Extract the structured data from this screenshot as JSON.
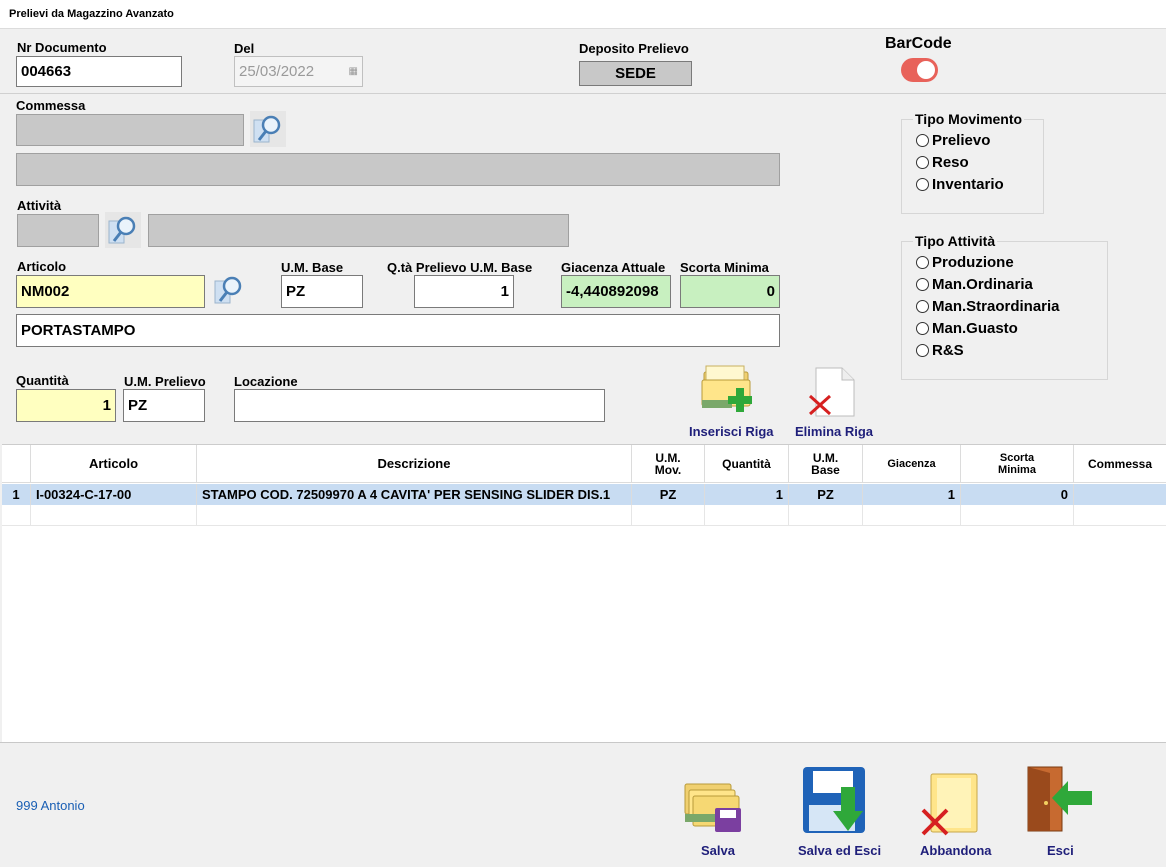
{
  "window": {
    "title": "Prelievi da Magazzino Avanzato"
  },
  "header": {
    "nr_documento_label": "Nr Documento",
    "nr_documento_value": "004663",
    "del_label": "Del",
    "del_value": "25/03/2022",
    "deposito_label": "Deposito Prelievo",
    "deposito_value": "SEDE",
    "barcode_label": "BarCode",
    "barcode_on": true
  },
  "form": {
    "commessa_label": "Commessa",
    "attivita_label": "Attività",
    "articolo_label": "Articolo",
    "articolo_value": "NM002",
    "um_base_label": "U.M. Base",
    "um_base_value": "PZ",
    "qta_prelievo_label": "Q.tà Prelievo U.M. Base",
    "qta_prelievo_value": "1",
    "giacenza_label": "Giacenza Attuale",
    "giacenza_value": "-4,440892098",
    "scorta_label": "Scorta Minima",
    "scorta_value": "0",
    "descrizione_value": "PORTASTAMPO",
    "quantita_label": "Quantità",
    "quantita_value": "1",
    "um_prelievo_label": "U.M. Prelievo",
    "um_prelievo_value": "PZ",
    "locazione_label": "Locazione",
    "locazione_value": ""
  },
  "tipo_movimento": {
    "title": "Tipo Movimento",
    "options": [
      "Prelievo",
      "Reso",
      "Inventario"
    ]
  },
  "tipo_attivita": {
    "title": "Tipo Attività",
    "options": [
      "Produzione",
      "Man.Ordinaria",
      "Man.Straordinaria",
      "Man.Guasto",
      "R&S"
    ]
  },
  "row_actions": {
    "inserisci_label": "Inserisci Riga",
    "elimina_label": "Elimina Riga"
  },
  "grid": {
    "headers": {
      "articolo": "Articolo",
      "descrizione": "Descrizione",
      "um_mov": "U.M.\nMov.",
      "quantita": "Quantità",
      "um_base": "U.M.\nBase",
      "giacenza": "Giacenza",
      "scorta_minima": "Scorta\nMinima",
      "commessa": "Commessa"
    },
    "rows": [
      {
        "n": "1",
        "articolo": "I-00324-C-17-00",
        "descrizione": "STAMPO COD. 72509970 A 4 CAVITA' PER SENSING SLIDER DIS.1",
        "um_mov": "PZ",
        "quantita": "1",
        "um_base": "PZ",
        "giacenza": "1",
        "scorta_minima": "0",
        "commessa": ""
      }
    ]
  },
  "footer": {
    "user": "999 Antonio",
    "salva_label": "Salva",
    "salva_esci_label": "Salva ed Esci",
    "abbandona_label": "Abbandona",
    "esci_label": "Esci"
  },
  "colors": {
    "toggle_on": "#e8625a",
    "selected_row": "#c8dcf2",
    "required_field": "#ffffc0",
    "readonly_green": "#c8f0c0",
    "action_text": "#1f1f7a",
    "user_text": "#1a5fb4"
  }
}
